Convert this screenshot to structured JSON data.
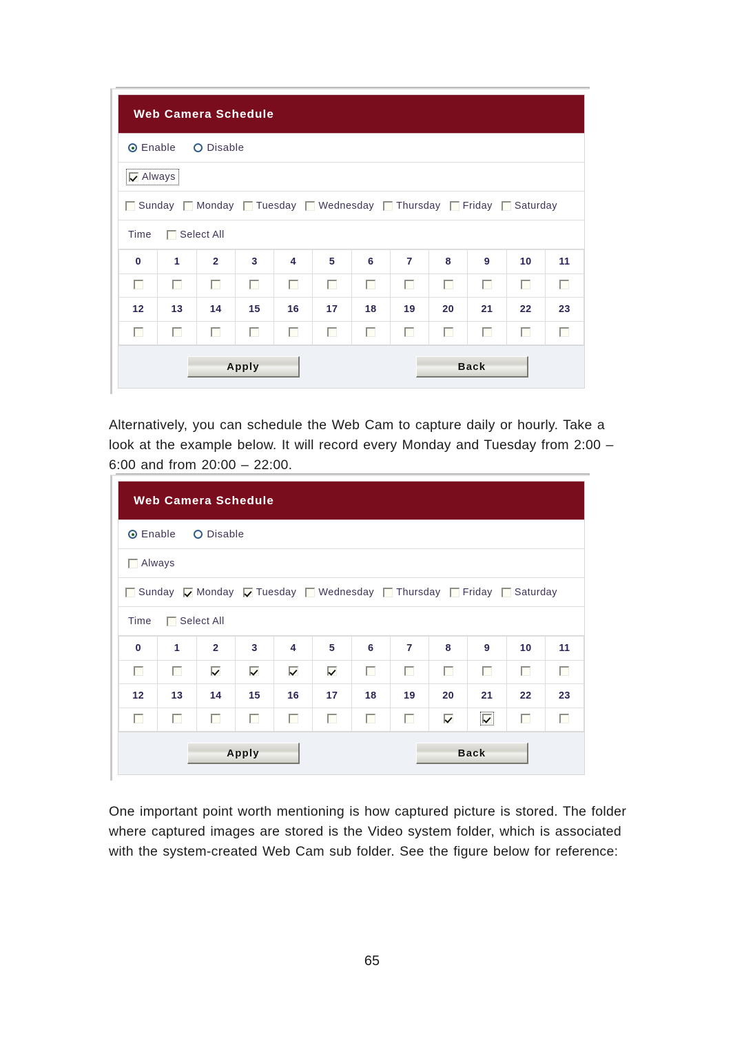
{
  "page": {
    "number": "65"
  },
  "paragraphs": {
    "alternatively": "Alternatively, you can schedule the Web Cam to capture daily or hourly. Take a look at the example below. It will record every Monday and Tuesday from 2:00 – 6:00 and from 20:00 – 22:00.",
    "storage": "One important point worth mentioning is how captured picture is stored. The folder where captured images are stored is the Video system folder, which is associated with the system-created Web Cam sub folder. See the figure below for reference:"
  },
  "colors": {
    "header_bar": "#7a0d1d",
    "header_text": "#ffffff",
    "label_text": "#3d2f55",
    "hour_text": "#2e2256",
    "footer_bg": "#eef2f7",
    "panel_border": "#d6d6d6"
  },
  "labels": {
    "enable": "Enable",
    "disable": "Disable",
    "always": "Always",
    "time": "Time",
    "select_all": "Select All",
    "apply": "Apply",
    "back": "Back"
  },
  "days": [
    "Sunday",
    "Monday",
    "Tuesday",
    "Wednesday",
    "Thursday",
    "Friday",
    "Saturday"
  ],
  "hours_row1": [
    "0",
    "1",
    "2",
    "3",
    "4",
    "5",
    "6",
    "7",
    "8",
    "9",
    "10",
    "11"
  ],
  "hours_row2": [
    "12",
    "13",
    "14",
    "15",
    "16",
    "17",
    "18",
    "19",
    "20",
    "21",
    "22",
    "23"
  ],
  "panel_1": {
    "title": "Web Camera Schedule",
    "mode": "Enable",
    "enable_checked": true,
    "disable_checked": false,
    "always_checked": true,
    "always_focused": true,
    "select_all_checked": false,
    "days_checked": [
      false,
      false,
      false,
      false,
      false,
      false,
      false
    ],
    "hours_row1_checked": [
      false,
      false,
      false,
      false,
      false,
      false,
      false,
      false,
      false,
      false,
      false,
      false
    ],
    "hours_row2_checked": [
      false,
      false,
      false,
      false,
      false,
      false,
      false,
      false,
      false,
      false,
      false,
      false
    ],
    "hours_row1_focused": [
      false,
      false,
      false,
      false,
      false,
      false,
      false,
      false,
      false,
      false,
      false,
      false
    ],
    "hours_row2_focused": [
      false,
      false,
      false,
      false,
      false,
      false,
      false,
      false,
      false,
      false,
      false,
      false
    ]
  },
  "panel_2": {
    "title": "Web Camera Schedule",
    "mode": "Enable",
    "enable_checked": true,
    "disable_checked": false,
    "always_checked": false,
    "always_focused": false,
    "select_all_checked": false,
    "days_checked": [
      false,
      true,
      true,
      false,
      false,
      false,
      false
    ],
    "hours_row1_checked": [
      false,
      false,
      true,
      true,
      true,
      true,
      false,
      false,
      false,
      false,
      false,
      false
    ],
    "hours_row2_checked": [
      false,
      false,
      false,
      false,
      false,
      false,
      false,
      false,
      true,
      true,
      false,
      false
    ],
    "hours_row1_focused": [
      false,
      false,
      false,
      false,
      false,
      false,
      false,
      false,
      false,
      false,
      false,
      false
    ],
    "hours_row2_focused": [
      false,
      false,
      false,
      false,
      false,
      false,
      false,
      false,
      false,
      true,
      false,
      false
    ]
  }
}
